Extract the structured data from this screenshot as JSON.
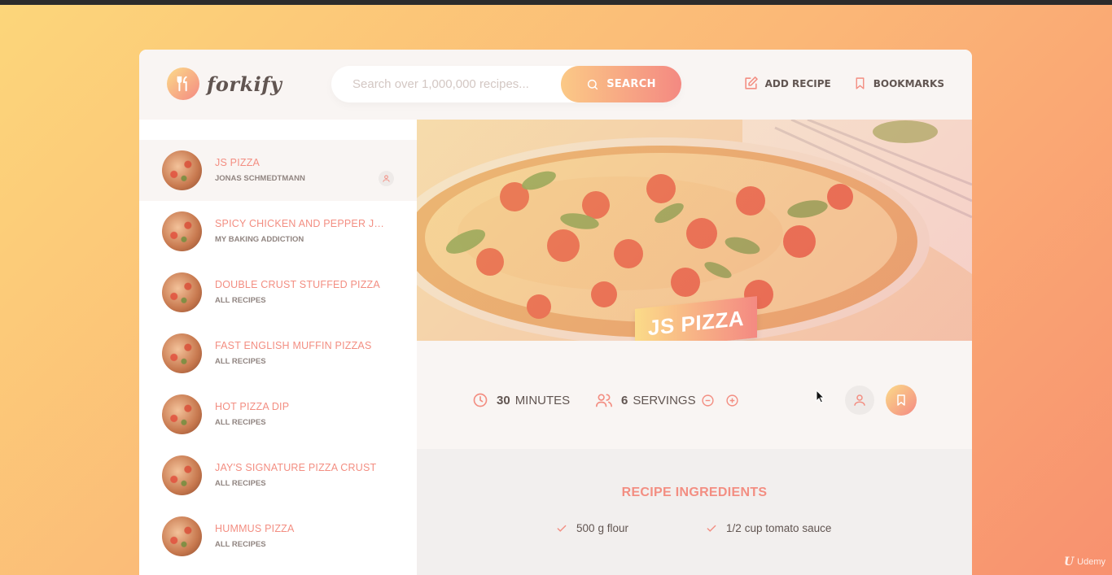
{
  "app": {
    "name": "forkify"
  },
  "search": {
    "placeholder": "Search over 1,000,000 recipes...",
    "value": "",
    "button_label": "SEARCH"
  },
  "nav": {
    "add_recipe": "ADD RECIPE",
    "bookmarks": "BOOKMARKS"
  },
  "results": [
    {
      "title": "JS PIZZA",
      "publisher": "JONAS SCHMEDTMANN",
      "active": true,
      "user_generated": true
    },
    {
      "title": "SPICY CHICKEN AND PEPPER JACK PIZZA",
      "publisher": "MY BAKING ADDICTION"
    },
    {
      "title": "DOUBLE CRUST STUFFED PIZZA",
      "publisher": "ALL RECIPES"
    },
    {
      "title": "FAST ENGLISH MUFFIN PIZZAS",
      "publisher": "ALL RECIPES"
    },
    {
      "title": "HOT PIZZA DIP",
      "publisher": "ALL RECIPES"
    },
    {
      "title": "JAY'S SIGNATURE PIZZA CRUST",
      "publisher": "ALL RECIPES"
    },
    {
      "title": "HUMMUS PIZZA",
      "publisher": "ALL RECIPES"
    }
  ],
  "recipe": {
    "title": "JS PIZZA",
    "cooking_time": "30",
    "cooking_time_unit": "MINUTES",
    "servings": "6",
    "servings_unit": "SERVINGS",
    "ingredients_heading": "RECIPE INGREDIENTS",
    "ingredients": [
      {
        "quantity": "500",
        "description": "g flour"
      },
      {
        "quantity": "1/2",
        "description": "cup tomato sauce"
      }
    ]
  },
  "watermark": {
    "logo": "U",
    "text": "Udemy"
  },
  "colors": {
    "accent": "#f38e82",
    "gradient_start": "#fbdb89",
    "gradient_end": "#f48982",
    "text": "#615551"
  }
}
